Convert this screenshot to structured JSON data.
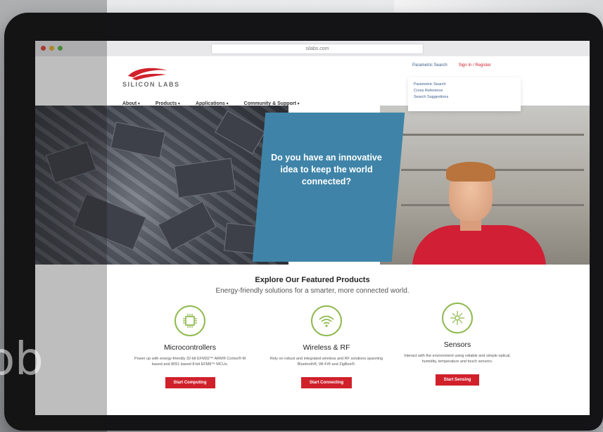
{
  "browser": {
    "url": "silabs.com"
  },
  "header": {
    "logo_text": "SILICON LABS",
    "util_links": [
      "Parametric Search",
      "Sign In / Register"
    ],
    "search_links": [
      "Parametric Search",
      "Cross Reference",
      "Search Suggestions"
    ],
    "nav": [
      "About",
      "Products",
      "Applications",
      "Community & Support"
    ]
  },
  "hero": {
    "headline": "Do you have an innovative idea to keep the world connected?"
  },
  "featured": {
    "title": "Explore Our Featured Products",
    "subtitle": "Energy-friendly solutions for a smarter, more connected world.",
    "products": [
      {
        "name": "Microcontrollers",
        "icon": "chip-icon",
        "description": "Power up with energy-friendly 32-bit EFM32™ ARM® Cortex®-M based and 8051 based 8-bit EFM8™ MCUs.",
        "button": "Start Computing"
      },
      {
        "name": "Wireless & RF",
        "icon": "wifi-icon",
        "description": "Rely on robust and integrated wireless and RF solutions spanning Bluetooth®, Wi-Fi® and ZigBee®.",
        "button": "Start Connecting"
      },
      {
        "name": "Sensors",
        "icon": "sensor-icon",
        "description": "Interact with the environment using reliable and simple optical, humidity, temperature and touch sensors.",
        "button": "Start Sensing"
      }
    ]
  },
  "colors": {
    "brand_red": "#d0212b",
    "panel_blue": "#3f84a8",
    "icon_green": "#8cb84a"
  },
  "watermark": "ob"
}
